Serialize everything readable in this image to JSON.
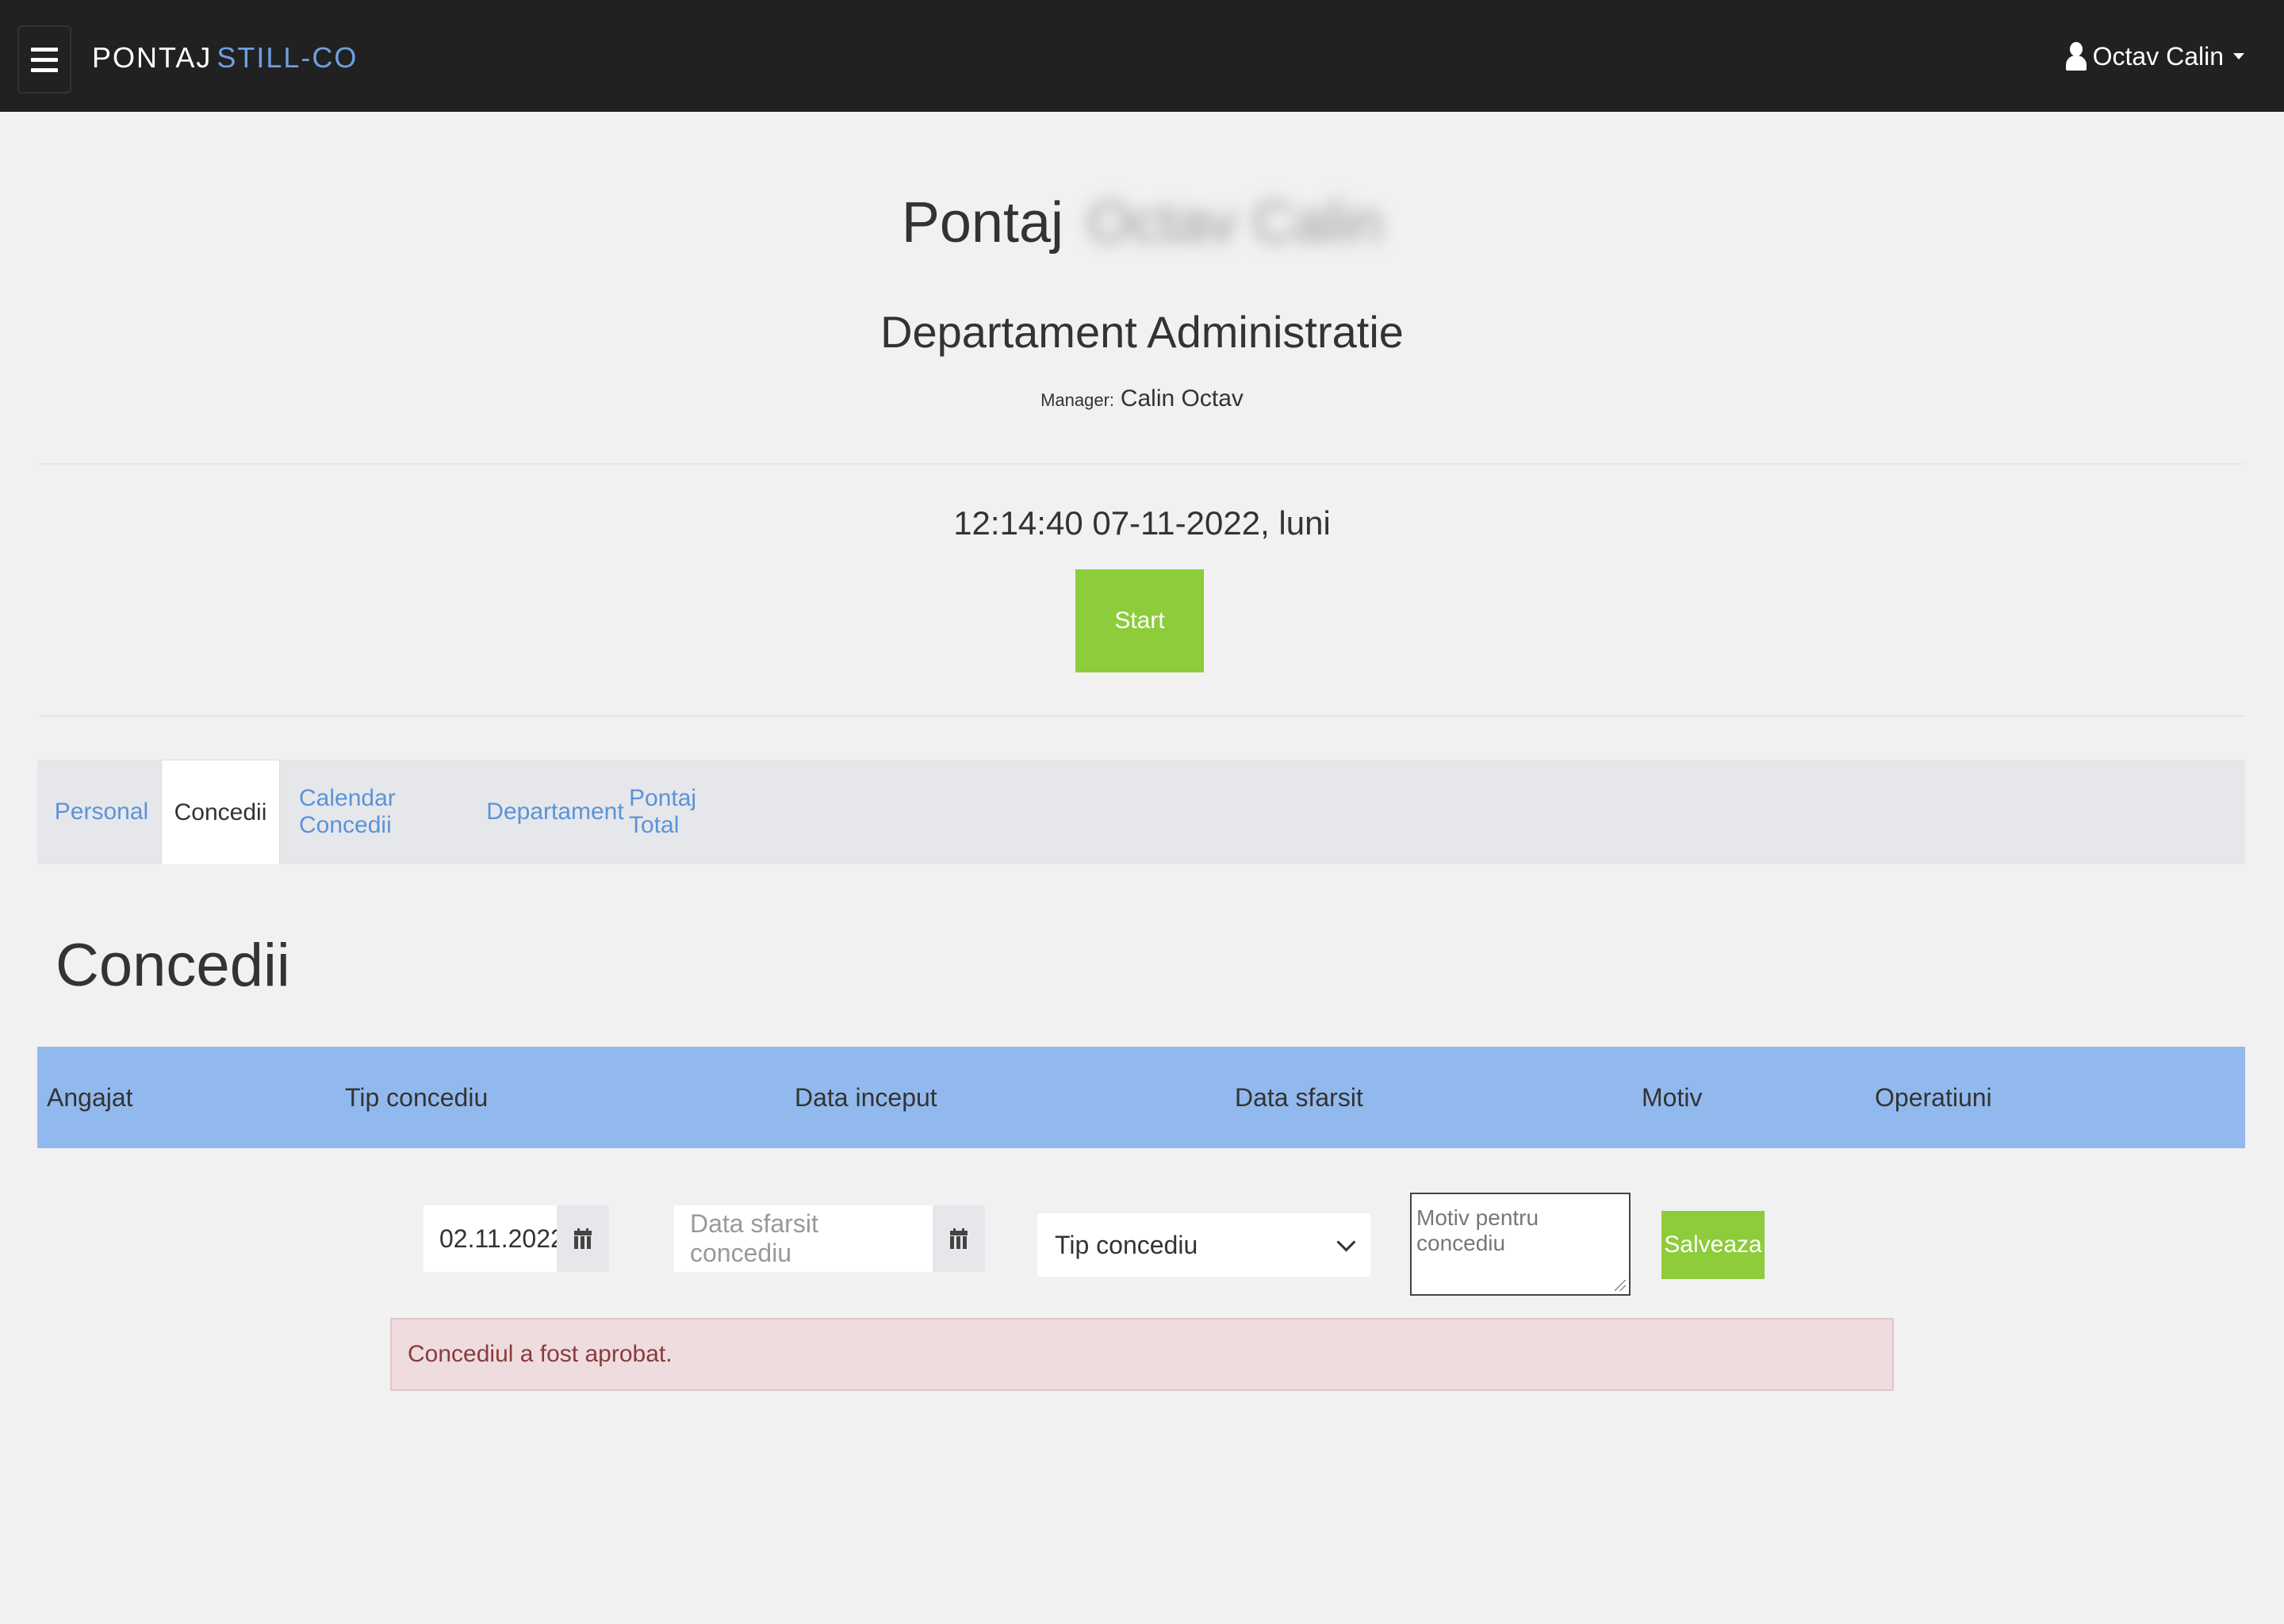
{
  "navbar": {
    "brand_main": "PONTAJ",
    "brand_accent": "STILL-CO",
    "user_name": "Octav Calin"
  },
  "header": {
    "title": "Pontaj",
    "title_blurred": "Octav Calin",
    "department": "Departament Administratie",
    "manager_label": "Manager:",
    "manager_name": "Calin Octav",
    "clock": "12:14:40 07-11-2022, luni",
    "start_label": "Start"
  },
  "tabs": [
    {
      "label": "Personal",
      "active": false
    },
    {
      "label": "Concedii",
      "active": true
    },
    {
      "label": "Calendar Concedii",
      "active": false
    },
    {
      "label": "Departament",
      "active": false
    },
    {
      "label": "Pontaj Total",
      "active": false
    }
  ],
  "section": {
    "heading": "Concedii"
  },
  "table": {
    "columns": [
      "Angajat",
      "Tip concediu",
      "Data inceput",
      "Data sfarsit",
      "Motiv",
      "Operatiuni"
    ]
  },
  "form": {
    "start_date_value": "02.11.2022",
    "end_date_placeholder": "Data sfarsit concediu",
    "type_selected": "Tip concediu",
    "reason_placeholder": "Motiv pentru concediu",
    "save_label": "Salveaza"
  },
  "alert": {
    "message": "Concediul a fost aprobat."
  },
  "colors": {
    "navbar_bg": "#212121",
    "brand_accent": "#6f9fe0",
    "button_green": "#8dcc3a",
    "table_head": "#92b9ee",
    "tab_link": "#5b93d8",
    "alert_bg": "#eedcdf"
  }
}
